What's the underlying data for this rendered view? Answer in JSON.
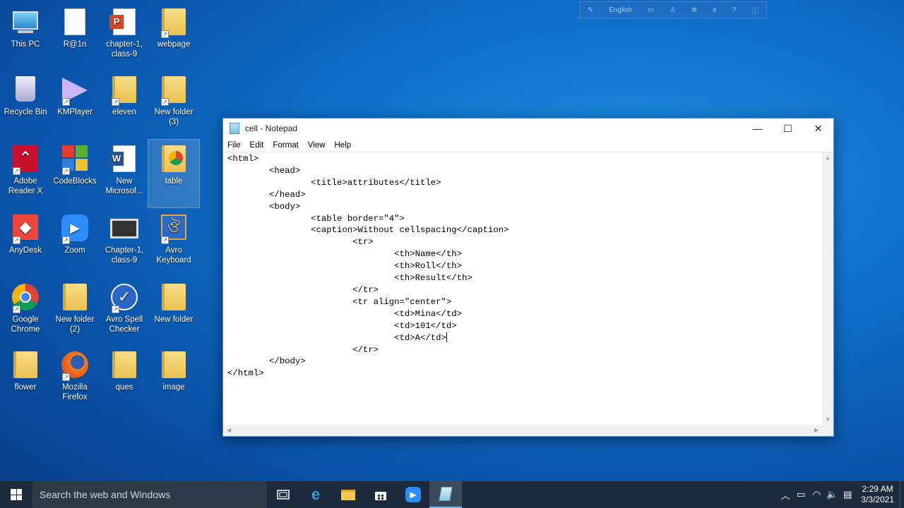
{
  "desktop": {
    "icons": [
      {
        "label": "This PC",
        "icon": "computer-icon"
      },
      {
        "label": "R@1n",
        "icon": "text-file-icon"
      },
      {
        "label": "chapter-1, class-9",
        "icon": "powerpoint-icon"
      },
      {
        "label": "webpage",
        "icon": "folder-icon"
      },
      {
        "label": "Recycle Bin",
        "icon": "recycle-bin-icon"
      },
      {
        "label": "KMPlayer",
        "icon": "kmplayer-icon"
      },
      {
        "label": "eleven",
        "icon": "folder-icon"
      },
      {
        "label": "New folder (3)",
        "icon": "folder-icon"
      },
      {
        "label": "Adobe Reader X",
        "icon": "adobe-reader-icon"
      },
      {
        "label": "CodeBlocks",
        "icon": "codeblocks-icon"
      },
      {
        "label": "New Microsof...",
        "icon": "word-icon"
      },
      {
        "label": "table",
        "icon": "chrome-html-file-icon"
      },
      {
        "label": "AnyDesk",
        "icon": "anydesk-icon"
      },
      {
        "label": "Zoom",
        "icon": "zoom-icon"
      },
      {
        "label": "Chapter-1, class-9",
        "icon": "video-file-icon"
      },
      {
        "label": "Avro Keyboard",
        "icon": "avro-keyboard-icon"
      },
      {
        "label": "Google Chrome",
        "icon": "chrome-icon"
      },
      {
        "label": "New folder (2)",
        "icon": "folder-icon"
      },
      {
        "label": "Avro Spell Checker",
        "icon": "avro-spell-checker-icon"
      },
      {
        "label": "New folder",
        "icon": "folder-icon"
      },
      {
        "label": "flower",
        "icon": "folder-icon"
      },
      {
        "label": "Mozilla Firefox",
        "icon": "firefox-icon"
      },
      {
        "label": "ques",
        "icon": "folder-icon"
      },
      {
        "label": "image",
        "icon": "folder-icon"
      }
    ]
  },
  "language_bar": {
    "label": "English"
  },
  "notepad": {
    "title": "cell - Notepad",
    "menu": [
      "File",
      "Edit",
      "Format",
      "View",
      "Help"
    ],
    "lines": [
      "<html>",
      "        <head>",
      "                <title>attributes</title>",
      "        </head>",
      "        <body>",
      "                <table border=\"4\">",
      "                <caption>Without cellspacing</caption>",
      "                        <tr>",
      "                                <th>Name</th>",
      "                                <th>Roll</th>",
      "                                <th>Result</th>",
      "                        </tr>",
      "                        <tr align=\"center\">",
      "                                <td>Mina</td>",
      "                                <td>101</td>",
      "                                <td>A</td>",
      "                        </tr>",
      "        </body>",
      "</html>"
    ]
  },
  "taskbar": {
    "search_placeholder": "Search the web and Windows",
    "time": "2:29 AM",
    "date": "3/3/2021"
  }
}
